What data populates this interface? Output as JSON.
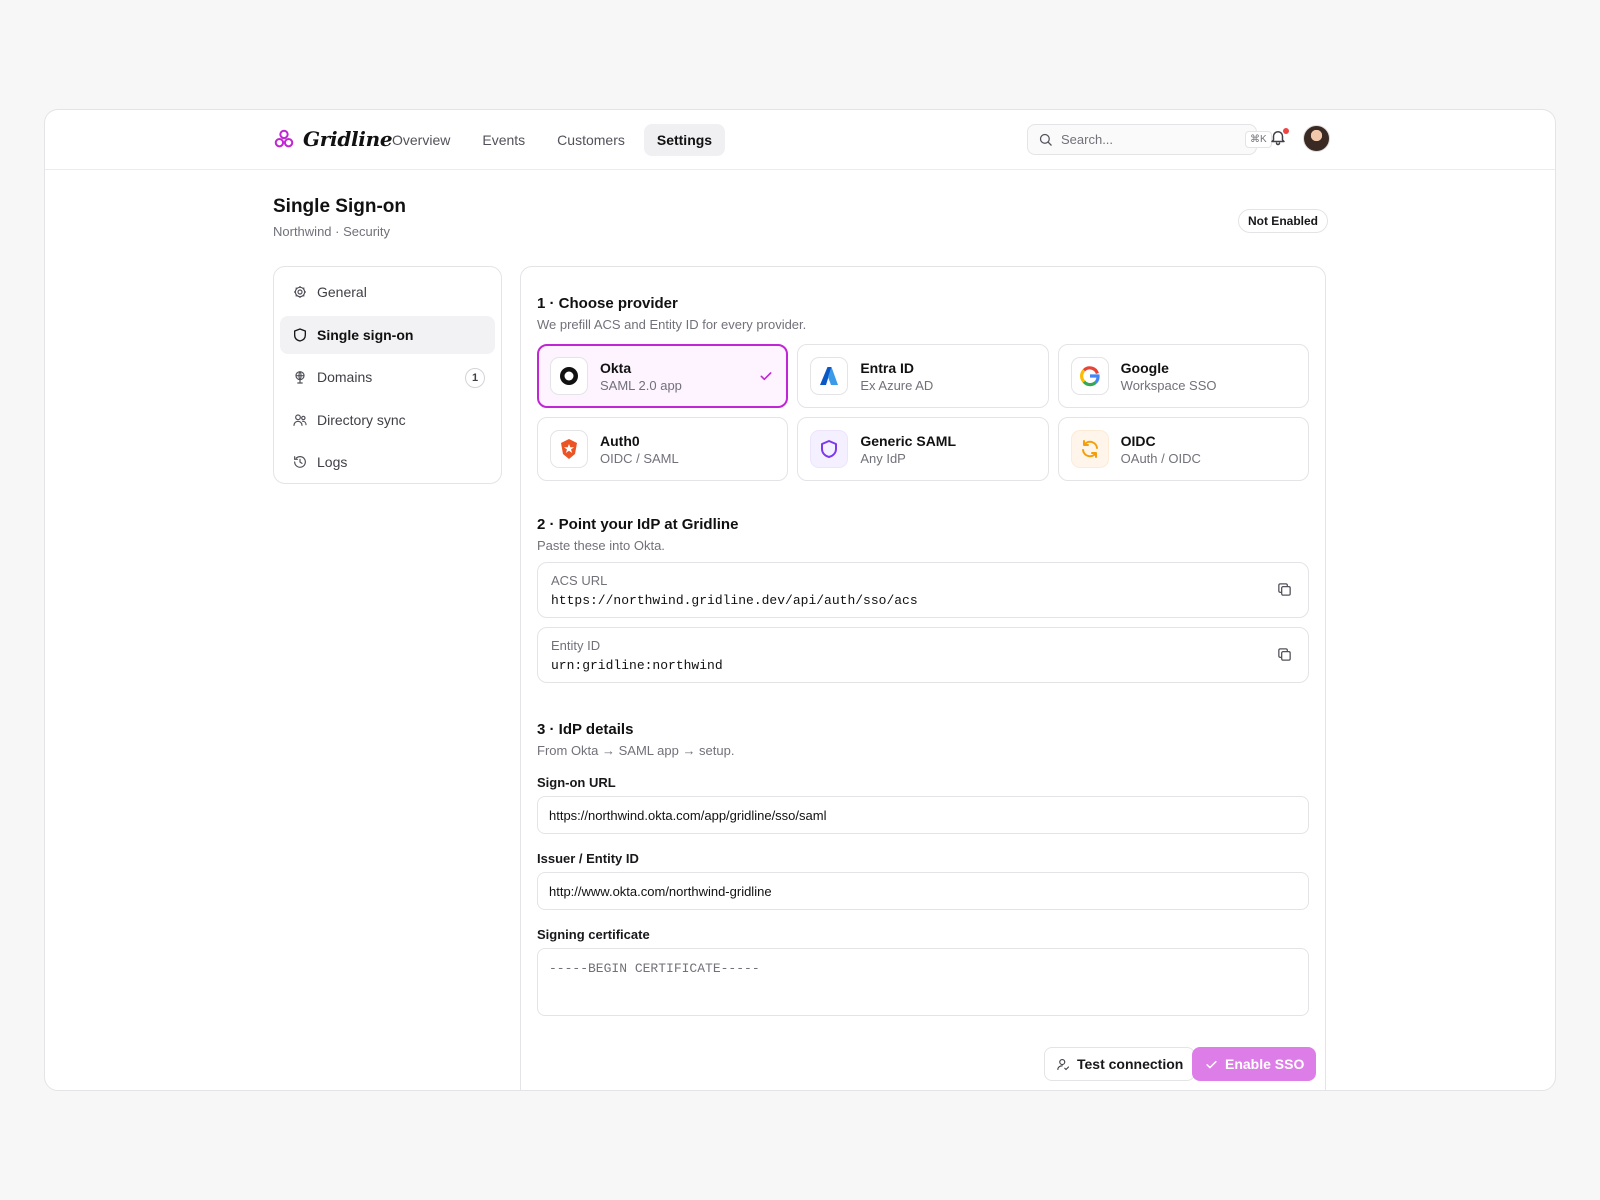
{
  "app": {
    "name": "Gridline"
  },
  "nav": {
    "items": [
      "Overview",
      "Events",
      "Customers",
      "Settings"
    ],
    "active": "Settings"
  },
  "search": {
    "placeholder": "Search...",
    "shortcut": "⌘K"
  },
  "page": {
    "title": "Single Sign-on",
    "breadcrumb": "Northwind · Security",
    "status": "Not Enabled"
  },
  "sidebar": {
    "items": [
      {
        "label": "General",
        "icon": "gear-icon"
      },
      {
        "label": "Single sign-on",
        "icon": "shield-icon",
        "active": true
      },
      {
        "label": "Domains",
        "icon": "globe-icon",
        "badge": "1"
      },
      {
        "label": "Directory sync",
        "icon": "users-icon"
      },
      {
        "label": "Logs",
        "icon": "history-icon"
      }
    ]
  },
  "step1": {
    "title": "1 · Choose provider",
    "subtitle": "We prefill ACS and Entity ID for every provider.",
    "providers": [
      {
        "name": "Okta",
        "sub": "SAML 2.0 app",
        "icon": "okta-logo-icon",
        "selected": true
      },
      {
        "name": "Entra ID",
        "sub": "Ex Azure AD",
        "icon": "entra-logo-icon"
      },
      {
        "name": "Google",
        "sub": "Workspace SSO",
        "icon": "google-logo-icon"
      },
      {
        "name": "Auth0",
        "sub": "OIDC / SAML",
        "icon": "auth0-logo-icon"
      },
      {
        "name": "Generic SAML",
        "sub": "Any IdP",
        "icon": "shield-icon"
      },
      {
        "name": "OIDC",
        "sub": "OAuth / OIDC",
        "icon": "refresh-icon"
      }
    ]
  },
  "step2": {
    "title": "2 · Point your IdP at Gridline",
    "subtitle": "Paste these into Okta.",
    "acs": {
      "label": "ACS URL",
      "value": "https://northwind.gridline.dev/api/auth/sso/acs"
    },
    "entity": {
      "label": "Entity ID",
      "value": "urn:gridline:northwind"
    }
  },
  "step3": {
    "title": "3 · IdP details",
    "subtitle": "From Okta → SAML app → setup.",
    "signon": {
      "label": "Sign-on URL",
      "value": "https://northwind.okta.com/app/gridline/sso/saml"
    },
    "issuer": {
      "label": "Issuer / Entity ID",
      "value": "http://www.okta.com/northwind-gridline"
    },
    "cert": {
      "label": "Signing certificate",
      "placeholder": "-----BEGIN CERTIFICATE-----"
    }
  },
  "actions": {
    "test": "Test connection",
    "enable": "Enable SSO"
  },
  "colors": {
    "accent": "#c026d3",
    "accent_soft": "#fdf4ff",
    "enable_bg": "#dd7ee8"
  }
}
